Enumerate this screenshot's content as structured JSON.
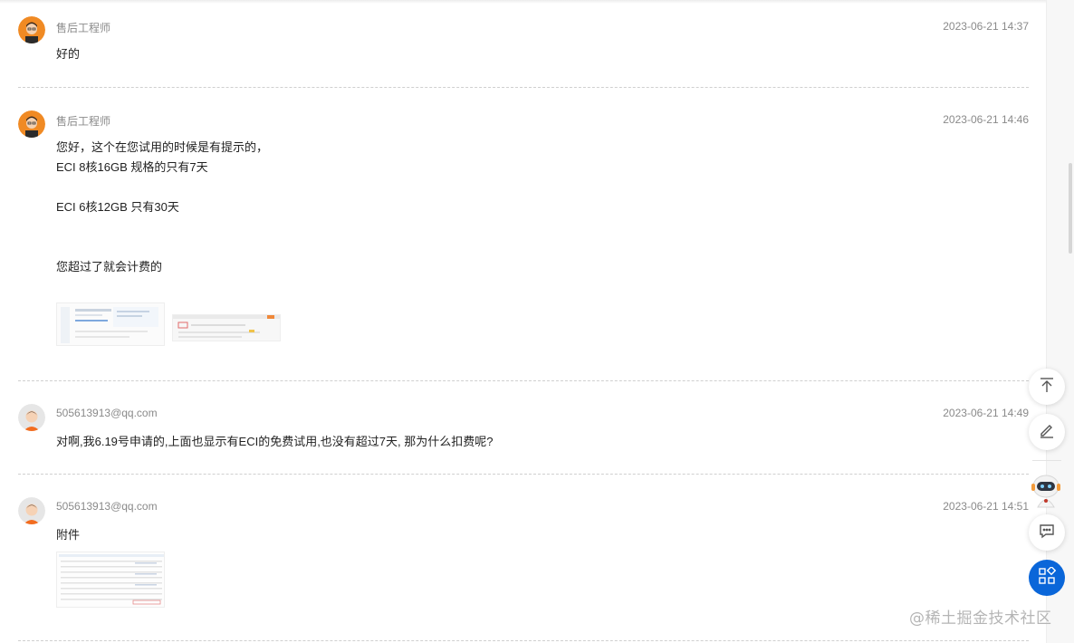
{
  "messages": [
    {
      "author": "售后工程师",
      "time": "2023-06-21 14:37",
      "lines": [
        "好的"
      ]
    },
    {
      "author": "售后工程师",
      "time": "2023-06-21 14:46",
      "lines": [
        "您好，这个在您试用的时候是有提示的，",
        "ECI 8核16GB 规格的只有7天",
        "ECI 6核12GB 只有30天",
        "您超过了就会计费的"
      ],
      "attachments": [
        "screenshot-thumbnail",
        "screenshot-thumbnail"
      ]
    },
    {
      "author": "505613913@qq.com",
      "time": "2023-06-21 14:49",
      "lines": [
        "对啊,我6.19号申请的,上面也显示有ECI的免费试用,也没有超过7天, 那为什么扣费呢?"
      ]
    },
    {
      "author": "505613913@qq.com",
      "time": "2023-06-21 14:51",
      "lines": [
        "附件"
      ],
      "attachments": [
        "screenshot-thumbnail"
      ]
    }
  ],
  "tools": {
    "back_to_top": "arrow-up-to-top-icon",
    "edit": "pen-edit-icon",
    "assistant": "robot-assistant-icon",
    "chat": "chat-bubble-icon",
    "apps": "apps-grid-icon"
  },
  "watermark": "@稀土掘金技术社区",
  "colors": {
    "accent": "#0a66d9",
    "engineer_avatar": "#f08a24",
    "user_avatar": "#f26c1f"
  }
}
